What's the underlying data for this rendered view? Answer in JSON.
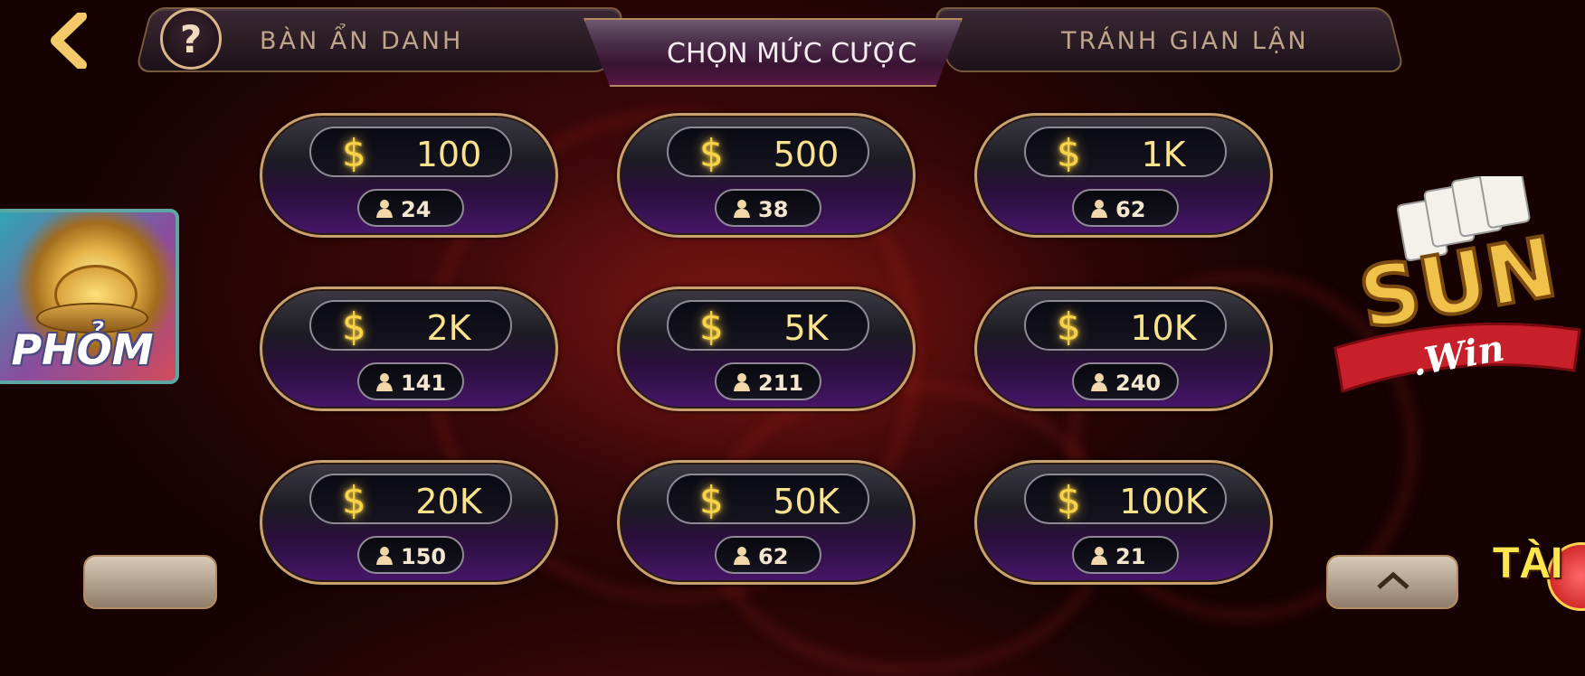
{
  "nav": {
    "back_icon": "chevron-left-icon",
    "help_symbol": "?",
    "tabs": [
      {
        "label": "BÀN ẨN DANH",
        "active": false
      },
      {
        "label": "CHỌN MỨC CƯỢC",
        "active": true
      },
      {
        "label": "TRÁNH GIAN LẬN",
        "active": false
      }
    ]
  },
  "bets": [
    {
      "amount": "100",
      "players": "24"
    },
    {
      "amount": "500",
      "players": "38"
    },
    {
      "amount": "1K",
      "players": "62"
    },
    {
      "amount": "2K",
      "players": "141"
    },
    {
      "amount": "5K",
      "players": "211"
    },
    {
      "amount": "10K",
      "players": "240"
    },
    {
      "amount": "20K",
      "players": "150"
    },
    {
      "amount": "50K",
      "players": "62"
    },
    {
      "amount": "100K",
      "players": "21"
    }
  ],
  "currency_symbol": "$",
  "side": {
    "game_card_label": "PHỎM",
    "logo_title": "SUN",
    "logo_subtitle": ".Win",
    "corner_label": "TÀI"
  },
  "colors": {
    "accent_gold": "#c9a26f",
    "bet_value": "#fbe38e",
    "tab_text": "#bfa58c",
    "active_tab_text": "#f4ecef"
  }
}
